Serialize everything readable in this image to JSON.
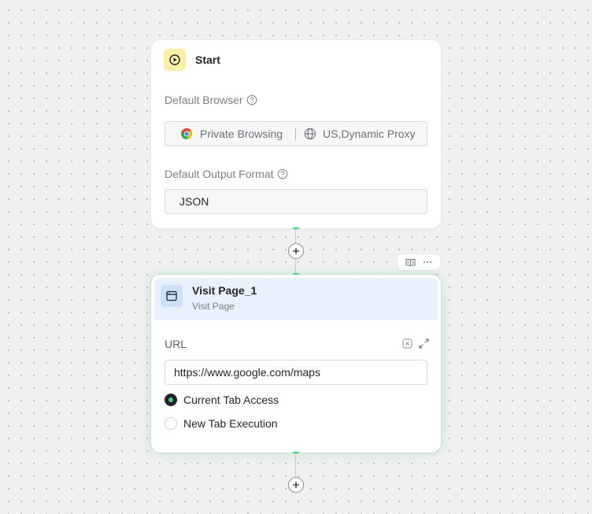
{
  "start_node": {
    "title": "Start",
    "icon": "play-circle-icon",
    "icon_bg": "#fdefa6",
    "default_browser_label": "Default Browser",
    "browser_mode": "Private Browsing",
    "proxy": "US,Dynamic Proxy",
    "default_output_label": "Default Output Format",
    "output_format": "JSON"
  },
  "node_toolbar": {
    "items": [
      "book-icon",
      "more-icon"
    ]
  },
  "visit_node": {
    "title": "Visit Page_1",
    "subtitle": "Visit Page",
    "icon": "browser-window-icon",
    "icon_bg": "#cfe0fb",
    "url_label": "URL",
    "url_value": "https://www.google.com/maps",
    "options": [
      {
        "label": "Current Tab Access",
        "selected": true
      },
      {
        "label": "New Tab Execution",
        "selected": false
      }
    ]
  },
  "colors": {
    "accent_green": "#3bd17b",
    "header_bg": "#e9f1fd"
  }
}
